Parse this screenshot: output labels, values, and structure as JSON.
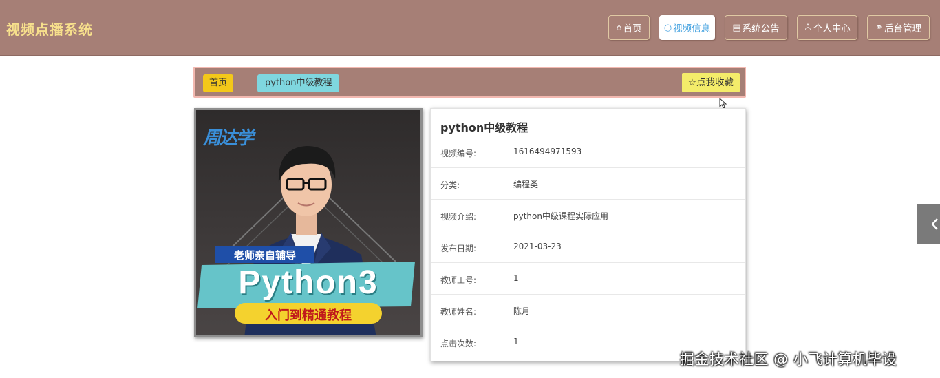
{
  "header": {
    "brand": "视频点播系统",
    "nav": [
      {
        "icon": "home-icon",
        "label": "首页",
        "active": false
      },
      {
        "icon": "circle-icon",
        "label": "视频信息",
        "active": true
      },
      {
        "icon": "notice-icon",
        "label": "系统公告",
        "active": false
      },
      {
        "icon": "user-icon",
        "label": "个人中心",
        "active": false
      },
      {
        "icon": "link-icon",
        "label": "后台管理",
        "active": false
      }
    ]
  },
  "breadcrumb": {
    "home": "首页",
    "current": "python中级教程",
    "favorite": "点我收藏"
  },
  "poster": {
    "logo": "周达学",
    "badge": "老师亲自辅导",
    "main": "Python3",
    "sub": "入门到精通教程"
  },
  "detail": {
    "title": "python中级教程",
    "rows": [
      {
        "key": "视频编号:",
        "value": "1616494971593"
      },
      {
        "key": "分类:",
        "value": "编程类"
      },
      {
        "key": "视频介绍:",
        "value": "python中级课程实际应用"
      },
      {
        "key": "发布日期:",
        "value": "2021-03-23"
      },
      {
        "key": "教师工号:",
        "value": "1"
      },
      {
        "key": "教师姓名:",
        "value": "陈月"
      },
      {
        "key": "点击次数:",
        "value": "1"
      }
    ]
  },
  "watermark": "掘金技术社区 @ 小飞计算机毕设",
  "colors": {
    "header": "#a67f76",
    "brand": "#f7e08c",
    "active_nav": "#46a3e0",
    "home_tag": "#f3c81a",
    "current_tag": "#7fd7df",
    "favorite": "#f4ec6a"
  }
}
